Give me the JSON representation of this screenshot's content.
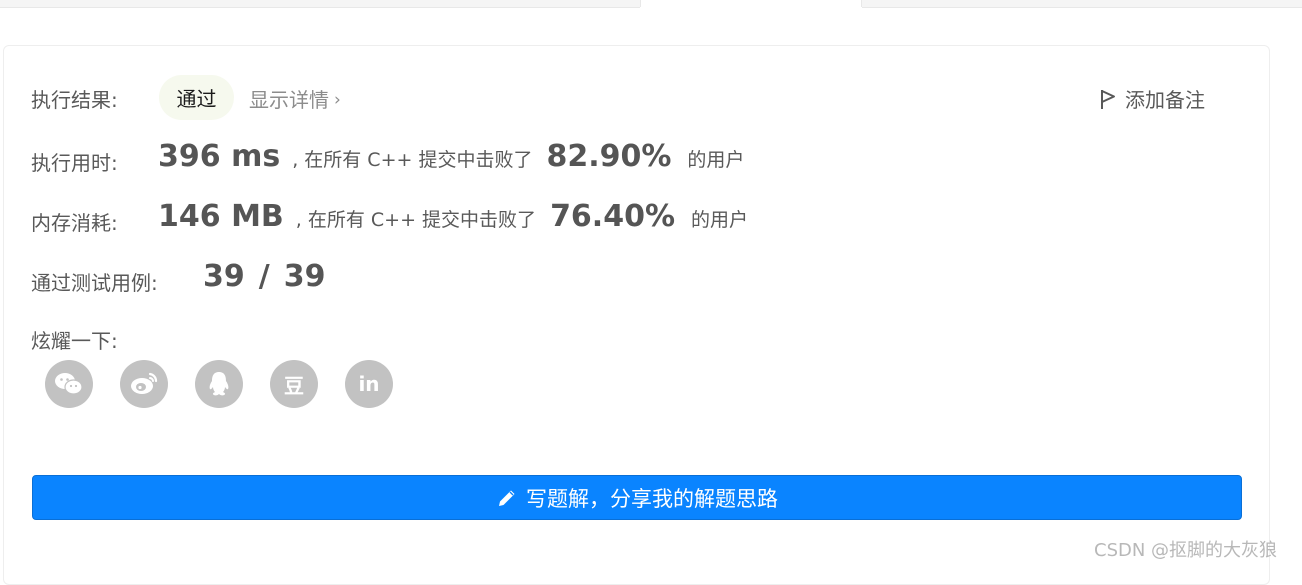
{
  "result": {
    "label": "执行结果:",
    "status": "通过",
    "details_link": "显示详情",
    "add_note": "添加备注"
  },
  "runtime": {
    "label": "执行用时:",
    "value": "396 ms",
    "middle": ", 在所有 C++ 提交中击败了",
    "percent": "82.90%",
    "suffix": "的用户"
  },
  "memory": {
    "label": "内存消耗:",
    "value": "146 MB",
    "middle": ", 在所有 C++ 提交中击败了",
    "percent": "76.40%",
    "suffix": "的用户"
  },
  "tests": {
    "label": "通过测试用例:",
    "passed": "39",
    "separator": "/",
    "total": "39"
  },
  "share": {
    "label": "炫耀一下:",
    "icons": [
      "wechat-icon",
      "weibo-icon",
      "qq-icon",
      "douban-icon",
      "linkedin-icon"
    ],
    "douban_glyph": "豆",
    "linkedin_glyph": "in"
  },
  "write_solution_button": "写题解，分享我的解题思路",
  "watermark": "CSDN @抠脚的大灰狼",
  "colors": {
    "accent": "#0a84ff",
    "pass_bg": "#f6f9ee",
    "icon_gray": "#c2c2c2"
  }
}
